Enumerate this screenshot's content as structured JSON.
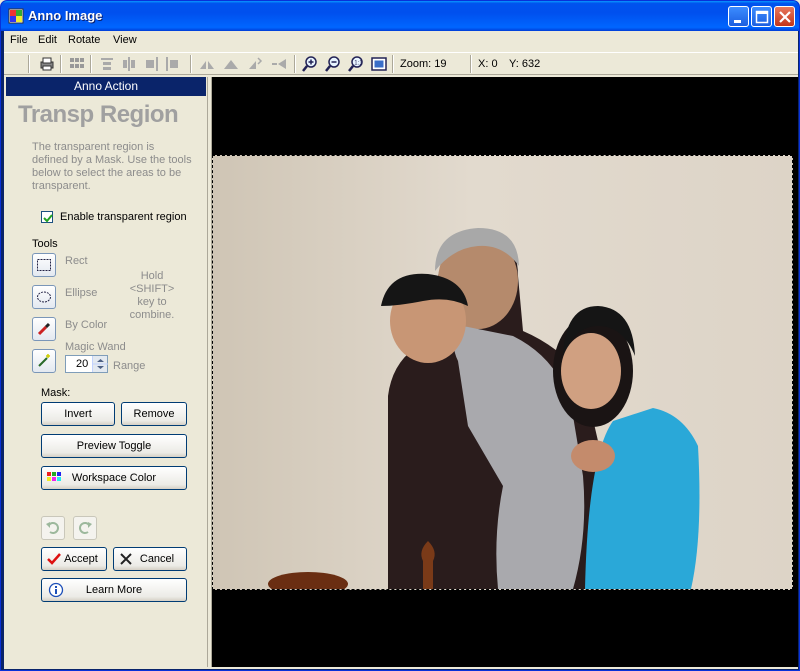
{
  "window": {
    "title": "Anno Image",
    "colors": {
      "titlebar": "#0050ee",
      "panel_header": "#0a246a",
      "canvas": "#000000"
    }
  },
  "menu": [
    {
      "label": "File"
    },
    {
      "label": "Edit"
    },
    {
      "label": "Rotate"
    },
    {
      "label": "View"
    }
  ],
  "toolbar": {
    "zoom": "Zoom: 19",
    "x": "X: 0",
    "y": "Y: 632",
    "icons": [
      "print-icon",
      "grid-icon",
      "align-top-icon",
      "align-center-icon",
      "align-right-icon",
      "align-left-icon",
      "flip-icon",
      "mirror-icon",
      "rotate-left-icon",
      "rotate-right-icon",
      "zoom-in-icon",
      "zoom-out-icon",
      "zoom-actual-icon",
      "fit-window-icon"
    ]
  },
  "panel": {
    "header": "Anno Action",
    "title": "Transp Region",
    "description": "The transparent region is defined by a Mask. Use the tools below to select the areas to be transparent.",
    "enable_label": "Enable transparent region",
    "enable_checked": true,
    "tools_label": "Tools",
    "tools": [
      {
        "label": "Rect",
        "icon": "rect-select-icon"
      },
      {
        "label": "Ellipse",
        "icon": "ellipse-select-icon"
      },
      {
        "label": "By Color",
        "icon": "eyedropper-icon"
      },
      {
        "label": "Magic Wand",
        "icon": "magic-wand-icon"
      }
    ],
    "hold_hint": "Hold <SHIFT> key to combine.",
    "range_value": "20",
    "range_label": "Range",
    "mask_label": "Mask:",
    "invert": "Invert",
    "remove": "Remove",
    "preview_toggle": "Preview Toggle",
    "workspace_color": "Workspace Color",
    "accept": "Accept",
    "cancel": "Cancel",
    "learn_more": "Learn More"
  }
}
